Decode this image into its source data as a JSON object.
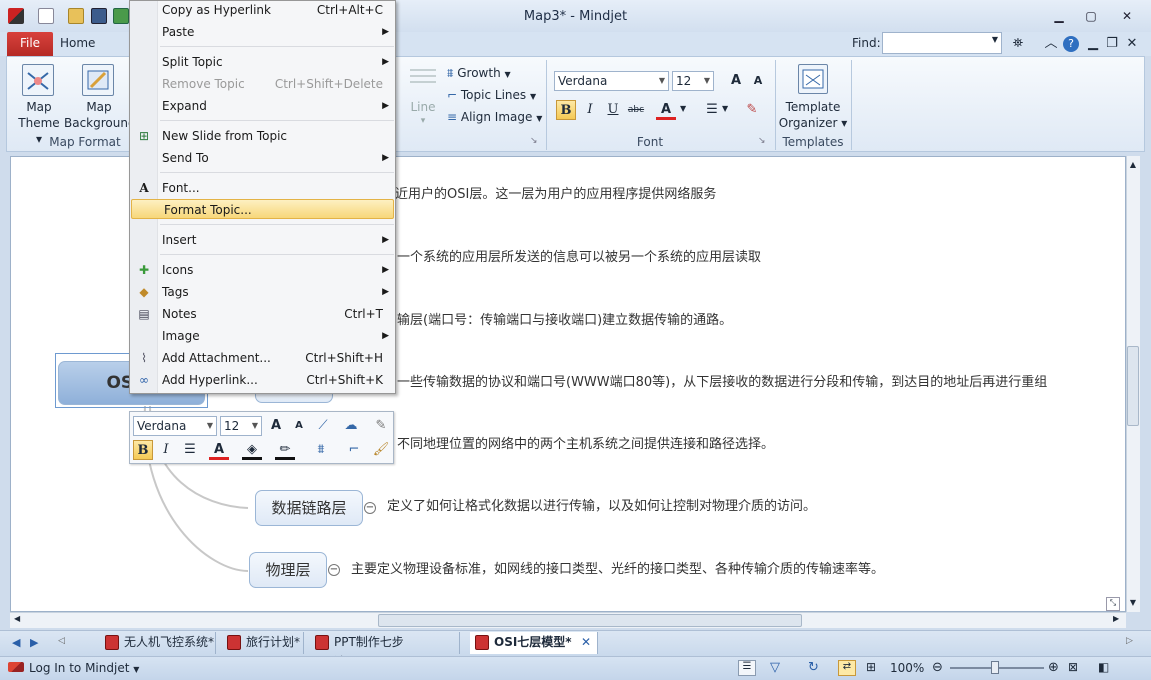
{
  "window": {
    "title": "Map3* - Mindjet"
  },
  "ribbon": {
    "file_tab": "File",
    "home_tab": "Home",
    "find_label": "Find:",
    "find_value": "",
    "map_theme": {
      "line1": "Map",
      "line2": "Theme"
    },
    "map_background": {
      "line1": "Map",
      "line2": "Background"
    },
    "map_format_group": "Map Format",
    "line_btn": "Line",
    "growth": "Growth",
    "topic_lines": "Topic Lines",
    "align_image": "Align Image",
    "font_name": "Verdana",
    "font_size": "12",
    "font_group": "Font",
    "template_organizer": {
      "line1": "Template",
      "line2": "Organizer"
    },
    "templates_group": "Templates"
  },
  "context_menu": [
    {
      "label": "Copy as Hyperlink",
      "shortcut": "Ctrl+Alt+C",
      "icon": "",
      "submenu": false,
      "disabled": false
    },
    {
      "label": "Paste",
      "shortcut": "",
      "icon": "",
      "submenu": true,
      "disabled": false
    },
    {
      "label": "Split Topic",
      "shortcut": "",
      "icon": "",
      "submenu": true,
      "disabled": false
    },
    {
      "label": "Remove Topic",
      "shortcut": "Ctrl+Shift+Delete",
      "icon": "",
      "submenu": false,
      "disabled": true
    },
    {
      "label": "Expand",
      "shortcut": "",
      "icon": "",
      "submenu": true,
      "disabled": false
    },
    {
      "label": "New Slide from Topic",
      "shortcut": "",
      "icon": "slide-icon",
      "submenu": false,
      "disabled": false
    },
    {
      "label": "Send To",
      "shortcut": "",
      "icon": "",
      "submenu": true,
      "disabled": false
    },
    {
      "label": "Font...",
      "shortcut": "",
      "icon": "font-icon",
      "submenu": false,
      "disabled": false
    },
    {
      "label": "Format Topic...",
      "shortcut": "",
      "icon": "",
      "submenu": false,
      "disabled": false,
      "highlighted": true
    },
    {
      "label": "Insert",
      "shortcut": "",
      "icon": "",
      "submenu": true,
      "disabled": false
    },
    {
      "label": "Icons",
      "shortcut": "",
      "icon": "icons-icon",
      "submenu": true,
      "disabled": false
    },
    {
      "label": "Tags",
      "shortcut": "",
      "icon": "tags-icon",
      "submenu": true,
      "disabled": false
    },
    {
      "label": "Notes",
      "shortcut": "Ctrl+T",
      "icon": "notes-icon",
      "submenu": false,
      "disabled": false
    },
    {
      "label": "Image",
      "shortcut": "",
      "icon": "",
      "submenu": true,
      "disabled": false
    },
    {
      "label": "Add Attachment...",
      "shortcut": "Ctrl+Shift+H",
      "icon": "paperclip-icon",
      "submenu": false,
      "disabled": false
    },
    {
      "label": "Add Hyperlink...",
      "shortcut": "Ctrl+Shift+K",
      "icon": "hyperlink-icon",
      "submenu": false,
      "disabled": false
    }
  ],
  "mini_toolbar": {
    "font_name": "Verdana",
    "font_size": "12"
  },
  "map": {
    "central_topic": "OSI七",
    "notes": [
      "近用户的OSI层。这一层为用户的应用程序提供网络服务",
      "一个系统的应用层所发送的信息可以被另一个系统的应用层读取",
      "输层(端口号：传输端口与接收端口)建立数据传输的通路。",
      "一些传输数据的协议和端口号(WWW端口80等)，从下层接收的数据进行分段和传输，到达目的地址后再进行重组",
      "不同地理位置的网络中的两个主机系统之间提供连接和路径选择。",
      "定义了如何让格式化数据以进行传输，以及如何让控制对物理介质的访问。",
      "主要定义物理设备标准，如网线的接口类型、光纤的接口类型、各种传输介质的传输速率等。"
    ],
    "topics": {
      "datalink": "数据链路层",
      "physical": "物理层"
    }
  },
  "doc_tabs": [
    "无人机飞控系统*",
    "旅行计划*",
    "PPT制作七步法.mmap*",
    "OSI七层模型*"
  ],
  "status": {
    "login": "Log In to Mindjet",
    "zoom": "100%"
  }
}
